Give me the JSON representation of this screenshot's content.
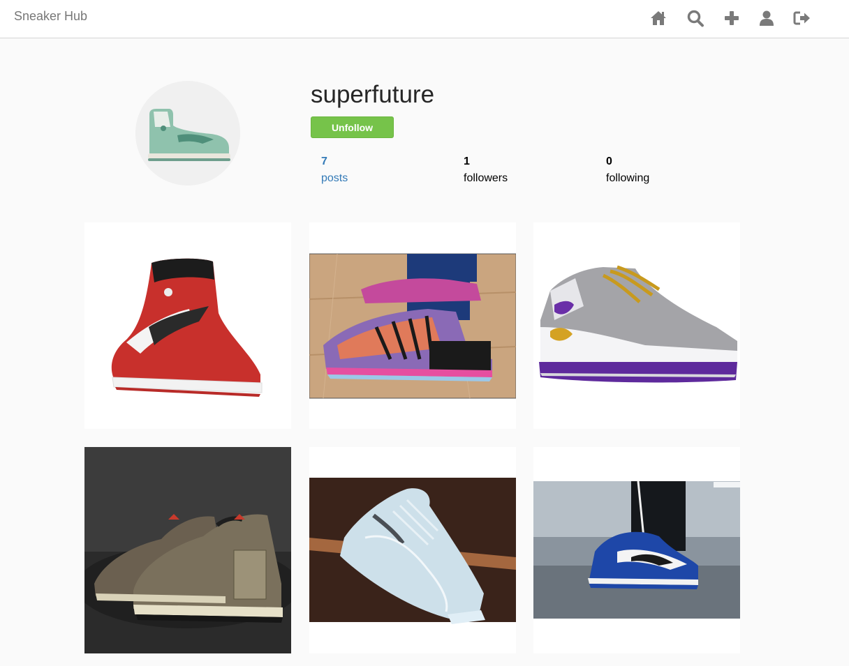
{
  "app": {
    "brand": "Sneaker Hub"
  },
  "nav": {
    "icons": [
      "home-icon",
      "search-icon",
      "plus-icon",
      "user-icon",
      "sign-out-icon"
    ],
    "icon_color": "#7a7a7a"
  },
  "profile": {
    "username": "superfuture",
    "follow_button_label": "Unfollow",
    "follow_button_color": "#76c34a",
    "stats": {
      "posts_count": "7",
      "posts_label": "posts",
      "followers_count": "1",
      "followers_label": "followers",
      "following_count": "0",
      "following_label": "following"
    },
    "link_color": "#337ab7"
  },
  "posts": [
    {
      "subject": "red-white-black high-top sneaker"
    },
    {
      "subject": "multicolor knit sneakers on court"
    },
    {
      "subject": "purple-gold-white high-top sneaker"
    },
    {
      "subject": "olive suede sneakers with hang tag"
    },
    {
      "subject": "light blue knit sneaker on wood"
    },
    {
      "subject": "blue-white high-top sneakers worn"
    }
  ]
}
